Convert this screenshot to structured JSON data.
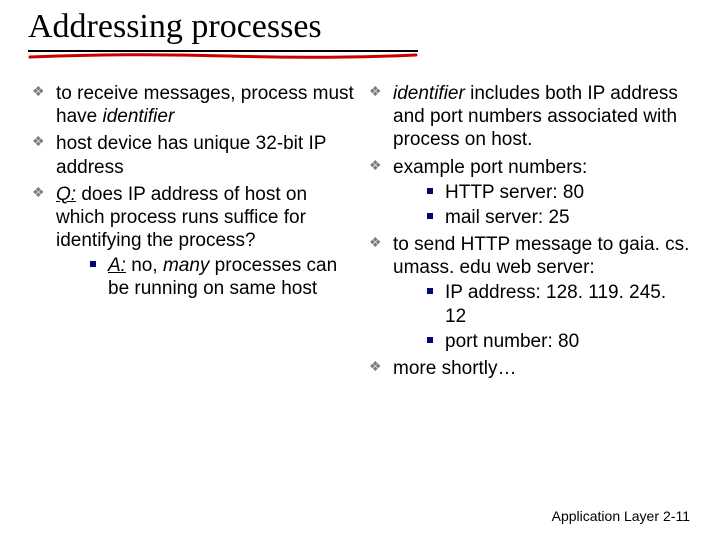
{
  "title": "Addressing processes",
  "left": {
    "b1_a": "to receive messages, process  must have ",
    "b1_b": "identifier",
    "b2": "host device has unique 32-bit IP address",
    "b3_a": "Q:",
    "b3_b": " does  IP address of host on which process runs suffice for identifying the process?",
    "b3_sub_a": "A:",
    "b3_sub_b": " no, ",
    "b3_sub_c": "many",
    "b3_sub_d": " processes can be running on same host"
  },
  "right": {
    "b1_a": "identifier",
    "b1_b": " includes both IP address and port numbers associated with process on host.",
    "b2": "example port numbers:",
    "b2_sub1": "HTTP server: 80",
    "b2_sub2": "mail server: 25",
    "b3": "to send HTTP message to gaia. cs. umass. edu web server:",
    "b3_sub1": "IP address: 128. 119. 245. 12",
    "b3_sub2": "port number: 80",
    "b4": "more shortly…"
  },
  "footer": {
    "label": "Application Layer",
    "page": "2-11"
  }
}
